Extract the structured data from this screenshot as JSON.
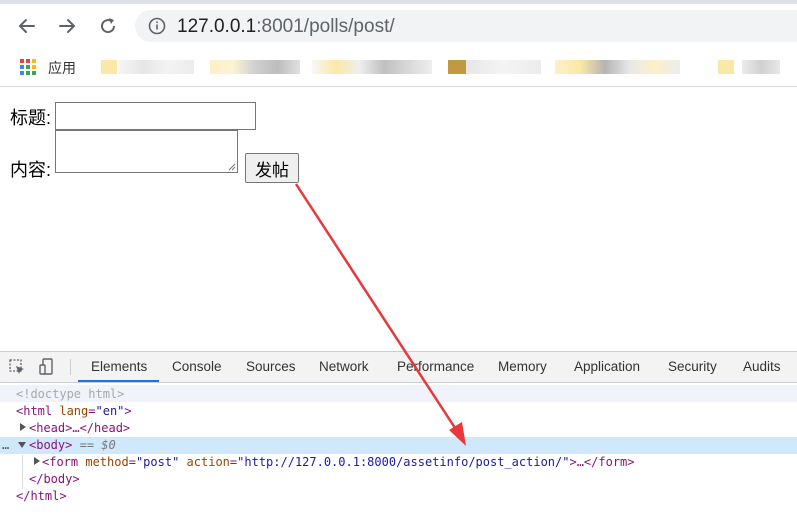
{
  "browser": {
    "url_host": "127.0.0.1",
    "url_rest": ":8001/polls/post/",
    "bookmarks_label": "应用"
  },
  "form": {
    "title_label": "标题:",
    "content_label": "内容:",
    "submit_label": "发帖"
  },
  "devtools": {
    "tabs": [
      "Elements",
      "Console",
      "Sources",
      "Network",
      "Performance",
      "Memory",
      "Application",
      "Security",
      "Audits"
    ],
    "active_tab": "Elements",
    "dom": {
      "doctype": "<!doctype html>",
      "html_open": "<html",
      "html_lang_attr": "lang",
      "html_lang_val": "\"en\"",
      "html_close_bracket": ">",
      "head": "<head>…</head>",
      "body_open": "<body>",
      "body_eq": "== $0",
      "form_open": "<form",
      "form_method_attr": "method",
      "form_method_val": "\"post\"",
      "form_action_attr": "action",
      "form_action_val": "\"http://127.0.0.1:8000/assetinfo/post_action/\"",
      "form_tail": ">…</form>",
      "body_close": "</body>",
      "html_close": "</html>"
    }
  },
  "colors": {
    "arrow": "#e8383b",
    "selected_row": "#cfe8fc",
    "active_tab_underline": "#1a73e8"
  }
}
